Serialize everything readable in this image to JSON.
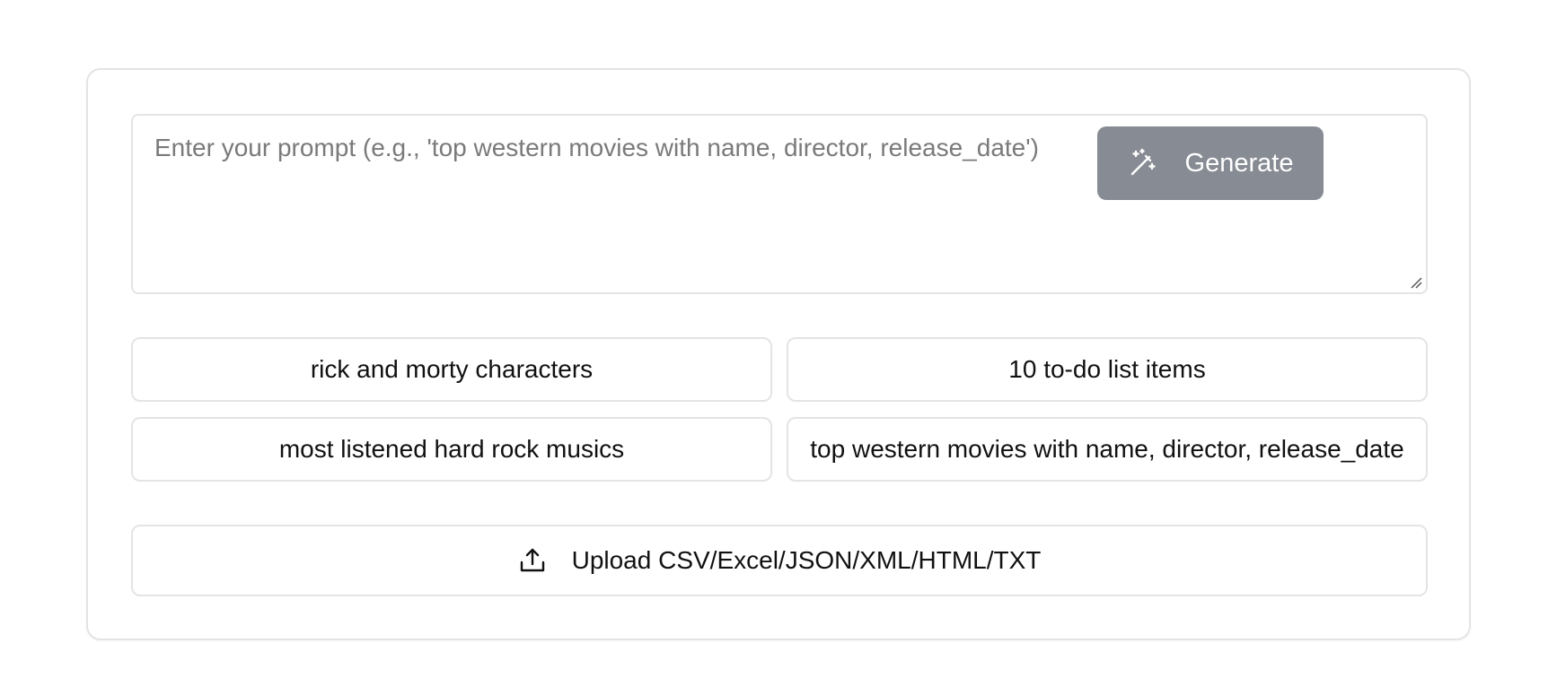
{
  "prompt": {
    "placeholder": "Enter your prompt (e.g., 'top western movies with name, director, release_date')",
    "value": ""
  },
  "generate_button": {
    "label": "Generate",
    "icon": "magic-wand-icon",
    "background": "#878b93"
  },
  "suggestions": [
    {
      "label": "rick and morty characters"
    },
    {
      "label": "10 to-do list items"
    },
    {
      "label": "most listened hard rock musics"
    },
    {
      "label": "top western movies with name, director, release_date"
    }
  ],
  "upload_button": {
    "label": "Upload CSV/Excel/JSON/XML/HTML/TXT",
    "icon": "upload-icon"
  }
}
